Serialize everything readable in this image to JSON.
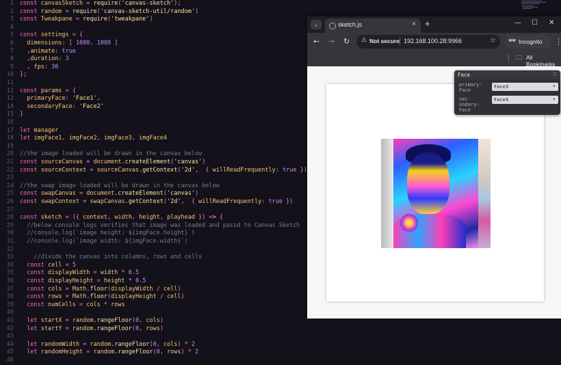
{
  "editor": {
    "line_numbers": [
      "1",
      "2",
      "3",
      "4",
      "5",
      "6",
      "7",
      "8",
      "9",
      "10",
      "11",
      "12",
      "13",
      "14",
      "15",
      "16",
      "17",
      "18",
      "19",
      "20",
      "21",
      "22",
      "23",
      "24",
      "25",
      "26",
      "27",
      "28",
      "29",
      "30",
      "31",
      "32",
      "33",
      "34",
      "35",
      "36",
      "37",
      "38",
      "39",
      "40",
      "41",
      "42",
      "43",
      "44",
      "45",
      "46"
    ],
    "lines": [
      "const canvasSketch = require('canvas-sketch');",
      "const random = require('canvas-sketch-util/random')",
      "const Tweakpane = require('tweakpane')",
      "",
      "const settings = {",
      "  dimensions: [ 1080, 1080 ]",
      "  ,animate: true",
      "  ,duration: 3",
      "  , fps: 30",
      "};",
      "",
      "const params = {",
      "  primaryFace: 'Face1',",
      "  secondaryFace: 'Face2'",
      "}",
      "",
      "let manager",
      "let imgFace1, imgFace2, imgFace3, imgFace4",
      "",
      "//the image loaded will be drawn in the canvas below",
      "const sourceCanvas = document.createElement('canvas')",
      "const sourceContext = sourceCanvas.getContext('2d',  { willReadFrequently: true })",
      "",
      "//the swap image loaded will be drawn in the canvas below",
      "const swapCanvas = document.createElement('canvas')",
      "const swapContext = swapCanvas.getContext('2d',  { willReadFrequently: true })",
      "",
      "const sketch = ({ context, width, height, playhead }) => {",
      "  //below console logs verifies that image was loaded and passd to Canvas Sketch",
      "  //console.log(`image height: ${imgFace.height}`)",
      "  //console.log(`image width: ${imgFace.width}`)",
      "",
      "    //divide the canvas into columns, rows and cells",
      "  const cell = 5",
      "  const displayWidth = width * 0.5",
      "  const displayHeight = height * 0.5",
      "  const cols = Math.floor(displayWidth / cell)",
      "  const rows = Math.floor(displayHeight / cell)",
      "  const numCells = cols * rows",
      "",
      "  let startX = random.rangeFloor(0, cols)",
      "  let startY = random.rangeFloor(0, rows)",
      "",
      "  let randomWidth = random.rangeFloor(0, cols) * 2",
      "  let randomHeight = random.rangeFloor(0, rows) * 2",
      ""
    ]
  },
  "browser": {
    "tab_title": "sketch.js",
    "tab_close": "×",
    "new_tab": "+",
    "tab_search_icon": "⌄",
    "window_controls": [
      "—",
      "☐",
      "✕"
    ],
    "nav": {
      "back": "←",
      "forward": "→",
      "reload": "↻"
    },
    "security_label": "Not secure",
    "url": "192.168.100.28:9966",
    "incognito_label": "Incognito",
    "bookmarks_label": "All Bookmarks",
    "menu_icon": "⋮"
  },
  "tweakpane": {
    "title": "Face",
    "rows": [
      {
        "label": "primary-\nFace",
        "value": "Face3"
      },
      {
        "label": "sec-\nondary-\nFace",
        "value": "Face4"
      }
    ]
  }
}
